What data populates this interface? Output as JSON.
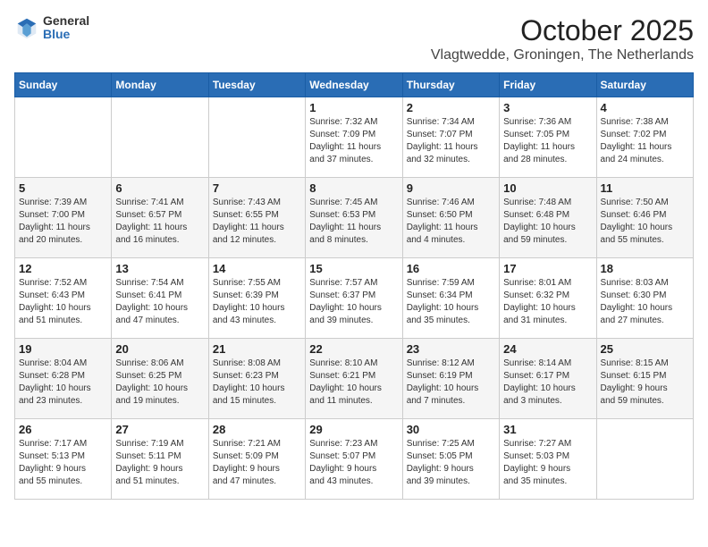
{
  "logo": {
    "general": "General",
    "blue": "Blue"
  },
  "title": "October 2025",
  "location": "Vlagtwedde, Groningen, The Netherlands",
  "headers": [
    "Sunday",
    "Monday",
    "Tuesday",
    "Wednesday",
    "Thursday",
    "Friday",
    "Saturday"
  ],
  "weeks": [
    [
      {
        "day": "",
        "info": ""
      },
      {
        "day": "",
        "info": ""
      },
      {
        "day": "",
        "info": ""
      },
      {
        "day": "1",
        "info": "Sunrise: 7:32 AM\nSunset: 7:09 PM\nDaylight: 11 hours\nand 37 minutes."
      },
      {
        "day": "2",
        "info": "Sunrise: 7:34 AM\nSunset: 7:07 PM\nDaylight: 11 hours\nand 32 minutes."
      },
      {
        "day": "3",
        "info": "Sunrise: 7:36 AM\nSunset: 7:05 PM\nDaylight: 11 hours\nand 28 minutes."
      },
      {
        "day": "4",
        "info": "Sunrise: 7:38 AM\nSunset: 7:02 PM\nDaylight: 11 hours\nand 24 minutes."
      }
    ],
    [
      {
        "day": "5",
        "info": "Sunrise: 7:39 AM\nSunset: 7:00 PM\nDaylight: 11 hours\nand 20 minutes."
      },
      {
        "day": "6",
        "info": "Sunrise: 7:41 AM\nSunset: 6:57 PM\nDaylight: 11 hours\nand 16 minutes."
      },
      {
        "day": "7",
        "info": "Sunrise: 7:43 AM\nSunset: 6:55 PM\nDaylight: 11 hours\nand 12 minutes."
      },
      {
        "day": "8",
        "info": "Sunrise: 7:45 AM\nSunset: 6:53 PM\nDaylight: 11 hours\nand 8 minutes."
      },
      {
        "day": "9",
        "info": "Sunrise: 7:46 AM\nSunset: 6:50 PM\nDaylight: 11 hours\nand 4 minutes."
      },
      {
        "day": "10",
        "info": "Sunrise: 7:48 AM\nSunset: 6:48 PM\nDaylight: 10 hours\nand 59 minutes."
      },
      {
        "day": "11",
        "info": "Sunrise: 7:50 AM\nSunset: 6:46 PM\nDaylight: 10 hours\nand 55 minutes."
      }
    ],
    [
      {
        "day": "12",
        "info": "Sunrise: 7:52 AM\nSunset: 6:43 PM\nDaylight: 10 hours\nand 51 minutes."
      },
      {
        "day": "13",
        "info": "Sunrise: 7:54 AM\nSunset: 6:41 PM\nDaylight: 10 hours\nand 47 minutes."
      },
      {
        "day": "14",
        "info": "Sunrise: 7:55 AM\nSunset: 6:39 PM\nDaylight: 10 hours\nand 43 minutes."
      },
      {
        "day": "15",
        "info": "Sunrise: 7:57 AM\nSunset: 6:37 PM\nDaylight: 10 hours\nand 39 minutes."
      },
      {
        "day": "16",
        "info": "Sunrise: 7:59 AM\nSunset: 6:34 PM\nDaylight: 10 hours\nand 35 minutes."
      },
      {
        "day": "17",
        "info": "Sunrise: 8:01 AM\nSunset: 6:32 PM\nDaylight: 10 hours\nand 31 minutes."
      },
      {
        "day": "18",
        "info": "Sunrise: 8:03 AM\nSunset: 6:30 PM\nDaylight: 10 hours\nand 27 minutes."
      }
    ],
    [
      {
        "day": "19",
        "info": "Sunrise: 8:04 AM\nSunset: 6:28 PM\nDaylight: 10 hours\nand 23 minutes."
      },
      {
        "day": "20",
        "info": "Sunrise: 8:06 AM\nSunset: 6:25 PM\nDaylight: 10 hours\nand 19 minutes."
      },
      {
        "day": "21",
        "info": "Sunrise: 8:08 AM\nSunset: 6:23 PM\nDaylight: 10 hours\nand 15 minutes."
      },
      {
        "day": "22",
        "info": "Sunrise: 8:10 AM\nSunset: 6:21 PM\nDaylight: 10 hours\nand 11 minutes."
      },
      {
        "day": "23",
        "info": "Sunrise: 8:12 AM\nSunset: 6:19 PM\nDaylight: 10 hours\nand 7 minutes."
      },
      {
        "day": "24",
        "info": "Sunrise: 8:14 AM\nSunset: 6:17 PM\nDaylight: 10 hours\nand 3 minutes."
      },
      {
        "day": "25",
        "info": "Sunrise: 8:15 AM\nSunset: 6:15 PM\nDaylight: 9 hours\nand 59 minutes."
      }
    ],
    [
      {
        "day": "26",
        "info": "Sunrise: 7:17 AM\nSunset: 5:13 PM\nDaylight: 9 hours\nand 55 minutes."
      },
      {
        "day": "27",
        "info": "Sunrise: 7:19 AM\nSunset: 5:11 PM\nDaylight: 9 hours\nand 51 minutes."
      },
      {
        "day": "28",
        "info": "Sunrise: 7:21 AM\nSunset: 5:09 PM\nDaylight: 9 hours\nand 47 minutes."
      },
      {
        "day": "29",
        "info": "Sunrise: 7:23 AM\nSunset: 5:07 PM\nDaylight: 9 hours\nand 43 minutes."
      },
      {
        "day": "30",
        "info": "Sunrise: 7:25 AM\nSunset: 5:05 PM\nDaylight: 9 hours\nand 39 minutes."
      },
      {
        "day": "31",
        "info": "Sunrise: 7:27 AM\nSunset: 5:03 PM\nDaylight: 9 hours\nand 35 minutes."
      },
      {
        "day": "",
        "info": ""
      }
    ]
  ]
}
